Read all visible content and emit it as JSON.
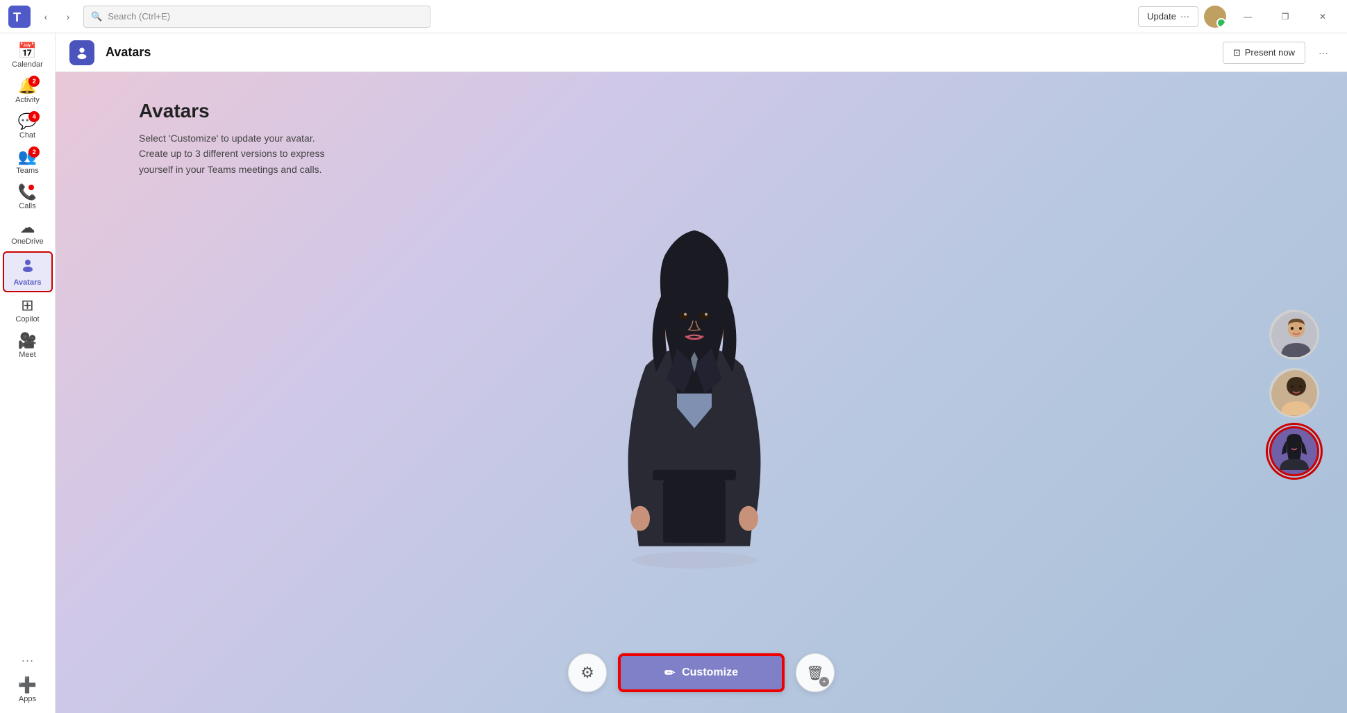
{
  "titlebar": {
    "search_placeholder": "Search (Ctrl+E)",
    "update_label": "Update",
    "update_dots": "···",
    "nav_back": "‹",
    "nav_forward": "›",
    "win_minimize": "—",
    "win_maximize": "❐",
    "win_close": "✕"
  },
  "sidebar": {
    "items": [
      {
        "id": "calendar",
        "label": "Calendar",
        "icon": "📅",
        "badge": null,
        "active": false
      },
      {
        "id": "activity",
        "label": "Activity",
        "icon": "🔔",
        "badge": "2",
        "active": false
      },
      {
        "id": "chat",
        "label": "Chat",
        "icon": "💬",
        "badge": "4",
        "active": false
      },
      {
        "id": "teams",
        "label": "Teams",
        "icon": "👥",
        "badge": "2",
        "active": false
      },
      {
        "id": "calls",
        "label": "Calls",
        "icon": "📞",
        "badge_dot": true,
        "active": false
      },
      {
        "id": "onedrive",
        "label": "OneDrive",
        "icon": "☁",
        "active": false
      },
      {
        "id": "avatars",
        "label": "Avatars",
        "icon": "🧑",
        "active": true
      },
      {
        "id": "copilot",
        "label": "Copilot",
        "icon": "⊞",
        "active": false
      },
      {
        "id": "meet",
        "label": "Meet",
        "icon": "🎥",
        "active": false
      }
    ],
    "more_label": "···",
    "apps_label": "Apps",
    "apps_icon": "➕"
  },
  "app_header": {
    "icon_char": "🧑",
    "title": "Avatars",
    "present_now_label": "Present now",
    "present_icon": "⊡",
    "more_options": "···"
  },
  "page": {
    "title": "Avatars",
    "description_line1": "Select 'Customize' to update your avatar.",
    "description_line2": "Create up to 3 different versions to express",
    "description_line3": "yourself in your Teams meetings and calls."
  },
  "avatar_thumbnails": [
    {
      "id": "avatar1",
      "selected": false,
      "bg": "#b0b0b0"
    },
    {
      "id": "avatar2",
      "selected": false,
      "bg": "#c09060"
    },
    {
      "id": "avatar3",
      "selected": true,
      "bg": "#7060a0"
    }
  ],
  "controls": {
    "settings_icon": "⚙",
    "customize_label": "Customize",
    "customize_pencil": "✏",
    "delete_icon": "🗑"
  },
  "colors": {
    "accent_purple": "#5b5fc7",
    "active_bg": "#e8e8f8",
    "customize_bg": "#8080c8",
    "badge_red": "#cc0000",
    "selected_border": "#e00000"
  }
}
